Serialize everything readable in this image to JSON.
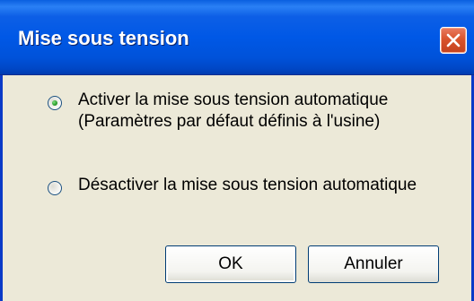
{
  "window": {
    "title": "Mise sous tension"
  },
  "options": [
    {
      "line1": "Activer la mise sous tension automatique",
      "line2": "(Paramètres par défaut définis à l'usine)",
      "selected": true
    },
    {
      "line1": "Désactiver la mise sous tension automatique",
      "line2": "",
      "selected": false
    }
  ],
  "buttons": {
    "ok_label": "OK",
    "cancel_label": "Annuler"
  },
  "colors": {
    "titlebar": "#0058e6",
    "close_button": "#d9532c",
    "dialog_background": "#ece9d8"
  },
  "icons": {
    "close": "close-x-icon"
  }
}
